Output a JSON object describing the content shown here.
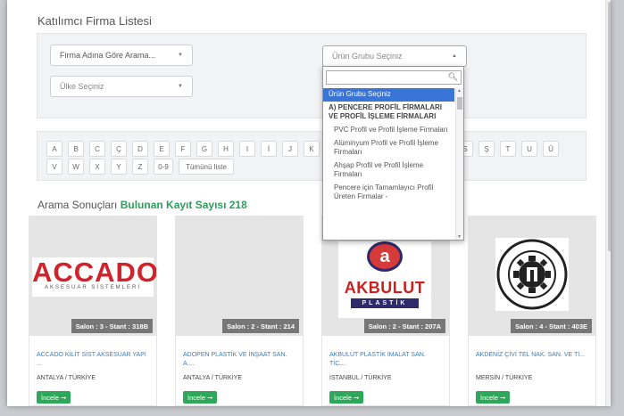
{
  "page_title": "Katılımcı Firma Listesi",
  "filters": {
    "company_search": "Firma Adına Göre Arama...",
    "country": "Ülke Seçiniz",
    "product_group": "Ürün Grubu Seçiniz"
  },
  "alphabet": {
    "row1": [
      "A",
      "B",
      "C",
      "Ç",
      "D",
      "E",
      "F",
      "G",
      "H",
      "I",
      "İ",
      "J",
      "K",
      "L"
    ],
    "row1_right": [
      "S",
      "Ş",
      "T",
      "U",
      "Ü"
    ],
    "row2": [
      "V",
      "W",
      "X",
      "Y",
      "Z",
      "0-9",
      "Tümünü liste"
    ]
  },
  "results": {
    "label": "Arama Sonuçları",
    "count_label": "Bulunan Kayıt Sayısı 218"
  },
  "dropdown": {
    "search_value": "",
    "items": [
      {
        "label": "Ürün Grubu Seçiniz",
        "kind": "selected"
      },
      {
        "label": "A) PENCERE PROFİL FİRMALARI VE PROFİL İŞLEME FİRMALARI",
        "kind": "group"
      },
      {
        "label": "PVC Profil ve Profil İşleme Firmaları",
        "kind": "item"
      },
      {
        "label": "Alüminyum Profil ve Profil İşleme Firmaları",
        "kind": "item"
      },
      {
        "label": "Ahşap Profil ve Profil İşleme Firmaları",
        "kind": "item"
      },
      {
        "label": "Pencere için Tamamlayıcı Profil Üreten Firmalar -",
        "kind": "item"
      }
    ]
  },
  "cards": [
    {
      "logo": "ACCADO",
      "logo_sub": "AKSESUAR SİSTEMLERİ",
      "stand": "Salon : 3 - Stant : 318B",
      "name": "ACCADO KİLİT SİST AKSESUAR YAPI ...",
      "location": "ANTALYA / TÜRKİYE",
      "button": "İncele ➞"
    },
    {
      "logo": "",
      "logo_sub": "",
      "stand": "Salon : 2 - Stant : 214",
      "name": "ADOPEN PLASTİK VE İNŞAAT SAN. A....",
      "location": "ANTALYA / TÜRKİYE",
      "button": "İncele ➞"
    },
    {
      "logo": "AKBULUT",
      "logo_sub": "PLASTİK",
      "stand": "Salon : 2 - Stant : 207A",
      "name": "AKBULUT PLASTİK İMALAT SAN. TİC....",
      "location": "İSTANBUL / TÜRKİYE",
      "button": "İncele ➞"
    },
    {
      "logo": "",
      "logo_sub": "",
      "stand": "Salon : 4 - Stant : 403E",
      "name": "AKDENİZ ÇİVİ TEL NAK. SAN. VE Tİ...",
      "location": "MERSİN / TÜRKİYE",
      "button": "İncele ➞"
    }
  ],
  "colors": {
    "accent_green": "#2ea75a",
    "link_blue": "#3b7ec2",
    "selected_blue": "#3875d7",
    "accado_red": "#d0232b",
    "akbulut_red": "#c8211f",
    "akbulut_purple": "#2f2a6b"
  }
}
